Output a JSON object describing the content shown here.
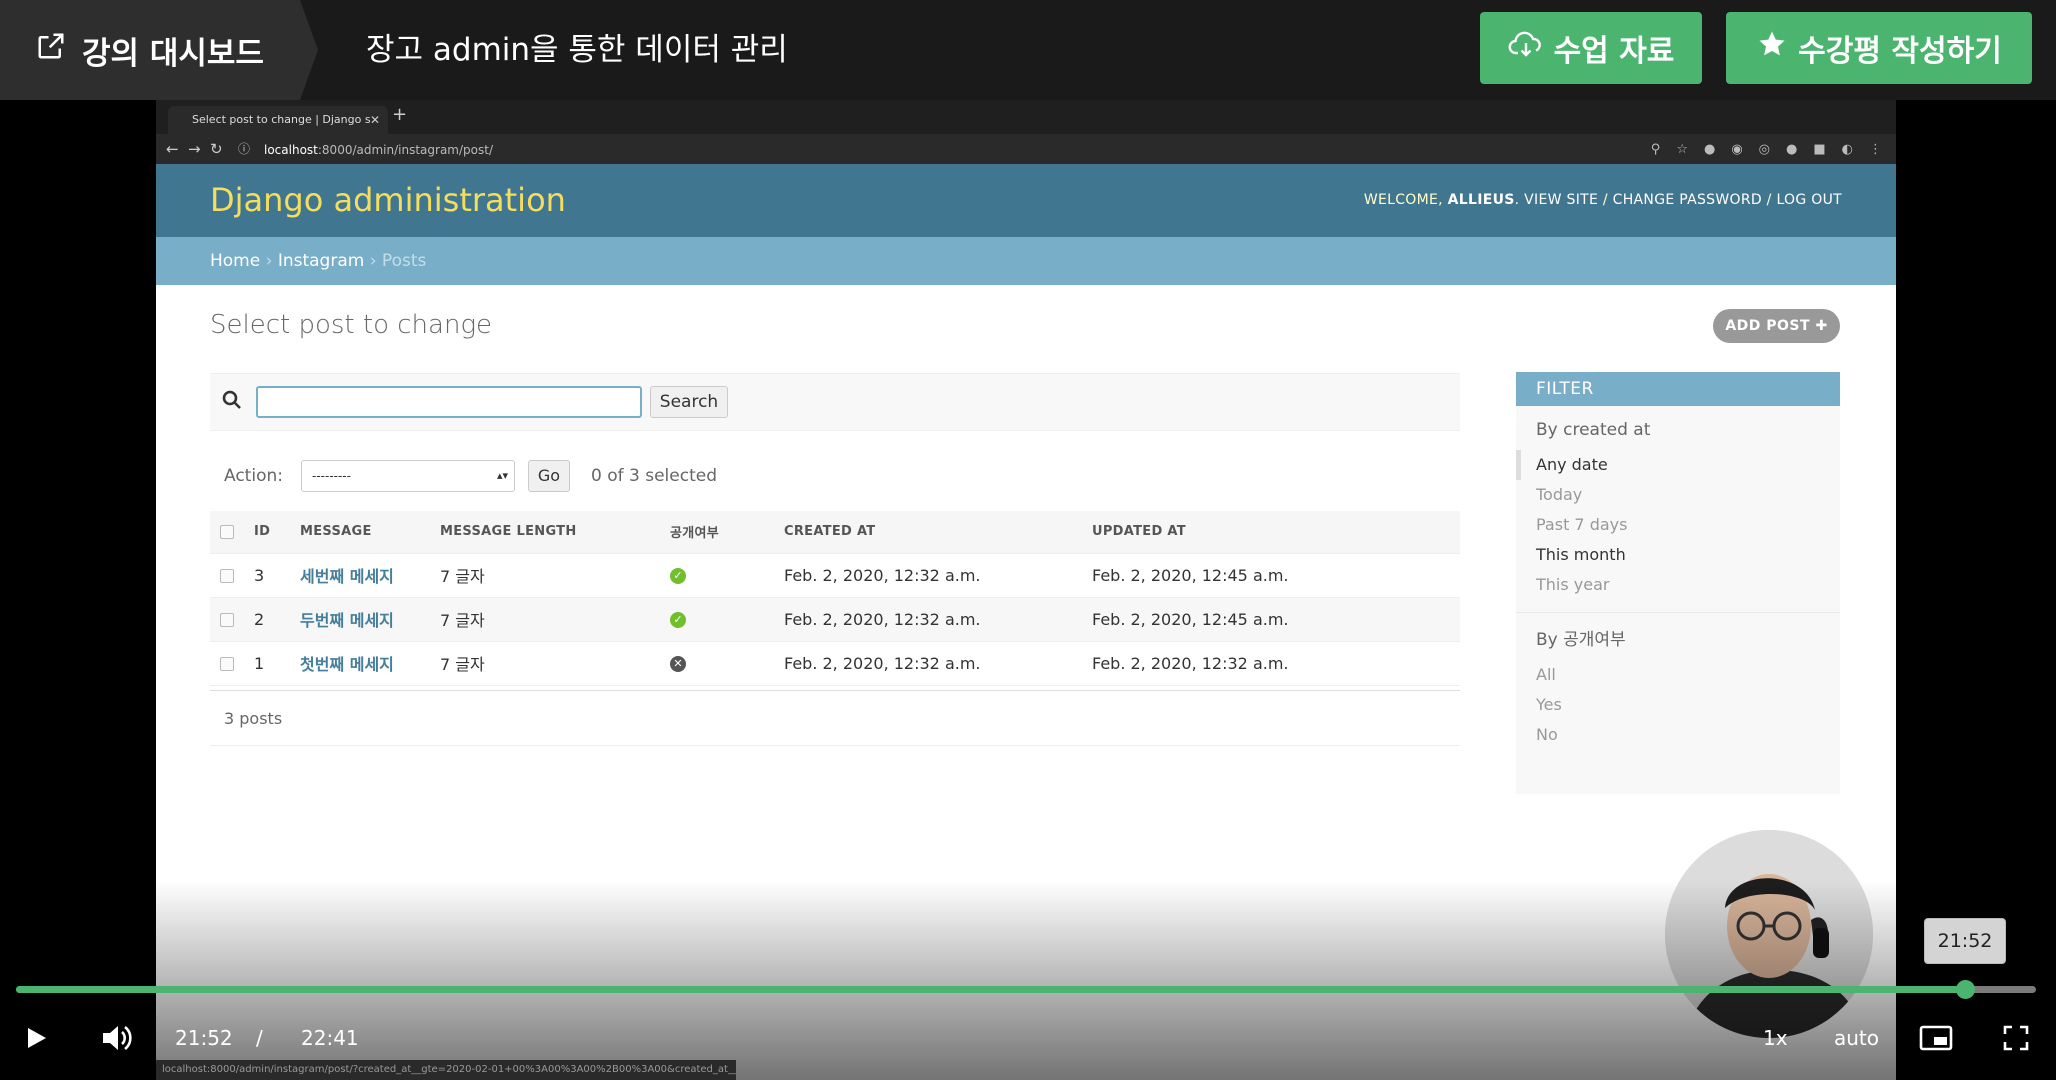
{
  "topbar": {
    "dashboard_label": "강의 대시보드",
    "lecture_title": "장고 admin을 통한 데이터 관리",
    "materials_button": "수업 자료",
    "review_button": "수강평 작성하기",
    "accent_color": "#4bb56f"
  },
  "browser": {
    "tab_title": "Select post to change | Django s",
    "url_host": "localhost",
    "url_rest": ":8000/admin/instagram/post/",
    "status_url": "localhost:8000/admin/instagram/post/?created_at__gte=2020-02-01+00%3A00%3A00%2B00%3A00&created_at__..."
  },
  "django": {
    "brand": "Django administration",
    "welcome_prefix": "WELCOME, ",
    "username": "ALLIEUS",
    "view_site": "VIEW SITE",
    "change_password": "CHANGE PASSWORD",
    "log_out": "LOG OUT",
    "breadcrumbs": [
      "Home",
      "Instagram",
      "Posts"
    ],
    "page_title": "Select post to change",
    "add_button": "ADD POST",
    "search_button": "Search",
    "search_value": "",
    "action_label": "Action:",
    "action_select": "---------",
    "go_button": "Go",
    "selected_counter": "0 of 3 selected",
    "columns": [
      "ID",
      "MESSAGE",
      "MESSAGE LENGTH",
      "공개여부",
      "CREATED AT",
      "UPDATED AT"
    ],
    "rows": [
      {
        "id": "3",
        "message": "세번째 메세지",
        "length": "7 글자",
        "public": true,
        "created": "Feb. 2, 2020, 12:32 a.m.",
        "updated": "Feb. 2, 2020, 12:45 a.m."
      },
      {
        "id": "2",
        "message": "두번째 메세지",
        "length": "7 글자",
        "public": true,
        "created": "Feb. 2, 2020, 12:32 a.m.",
        "updated": "Feb. 2, 2020, 12:45 a.m."
      },
      {
        "id": "1",
        "message": "첫번째 메세지",
        "length": "7 글자",
        "public": false,
        "created": "Feb. 2, 2020, 12:32 a.m.",
        "updated": "Feb. 2, 2020, 12:32 a.m."
      }
    ],
    "paginator": "3 posts",
    "filter": {
      "title": "FILTER",
      "created_group": "By created at",
      "created_options": [
        "Any date",
        "Today",
        "Past 7 days",
        "This month",
        "This year"
      ],
      "public_group": "By 공개여부",
      "public_options": [
        "All",
        "Yes",
        "No"
      ]
    }
  },
  "player": {
    "current_time": "21:52",
    "separator": "/",
    "duration": "22:41",
    "tooltip_time": "21:52",
    "progress": 0.9647,
    "speed": "1x",
    "quality": "auto"
  }
}
